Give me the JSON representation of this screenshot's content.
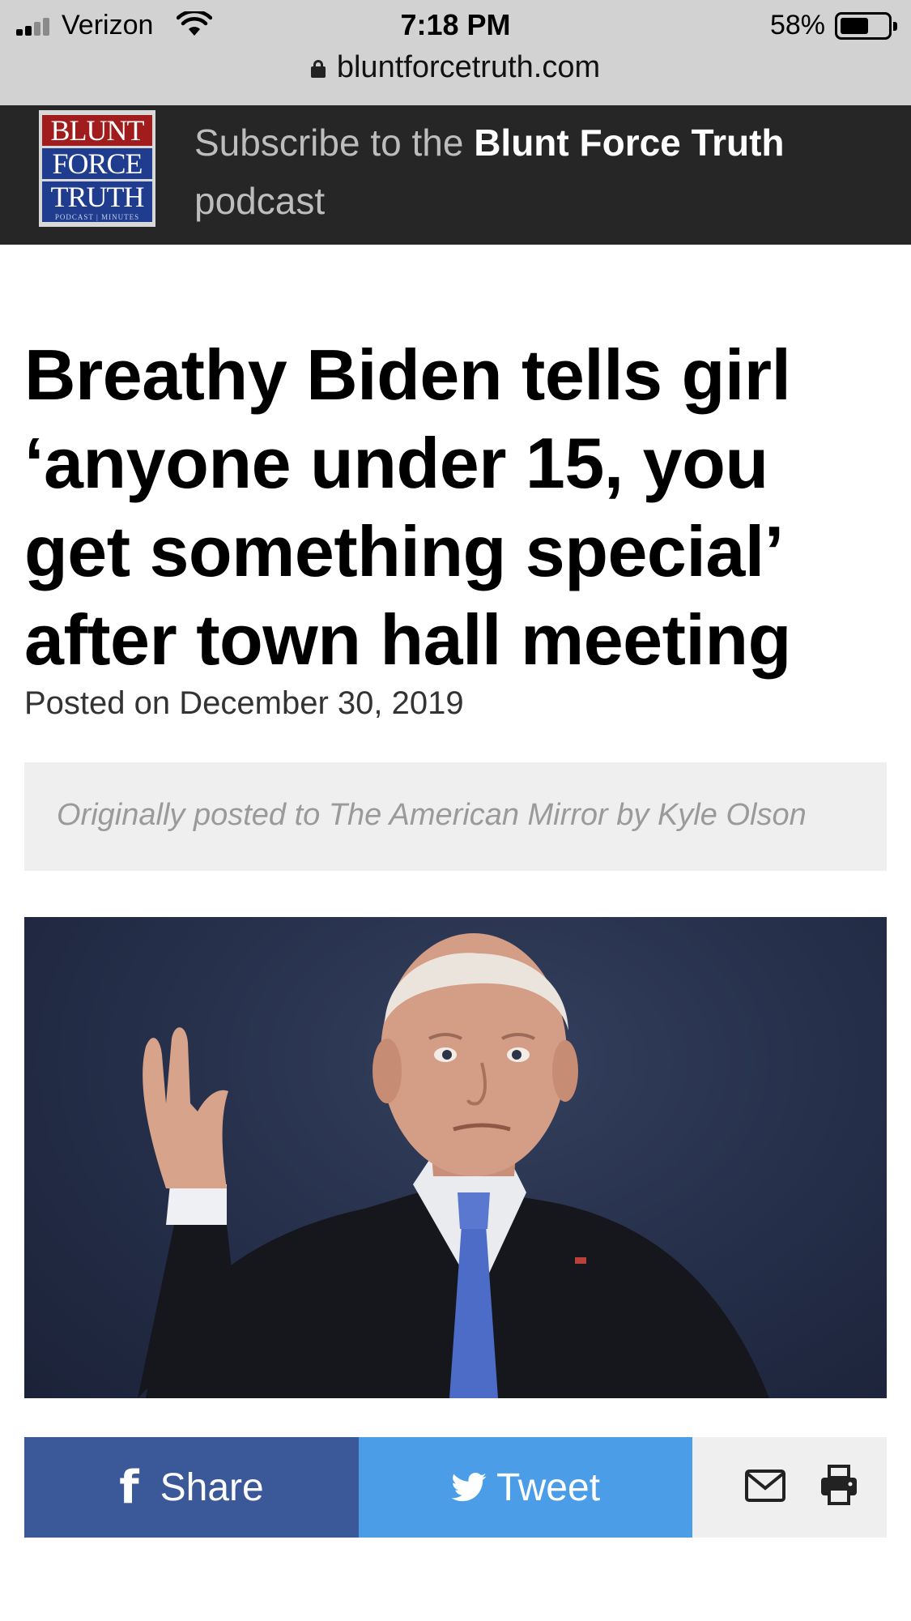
{
  "status_bar": {
    "carrier": "Verizon",
    "time": "7:18 PM",
    "battery_percent": "58%",
    "battery_level": 0.58
  },
  "browser": {
    "url": "bluntforcetruth.com"
  },
  "header": {
    "logo": {
      "line1": "BLUNT",
      "line2": "FORCE",
      "line3": "TRUTH",
      "line4": "PODCAST | MINUTES"
    },
    "subscribe_prefix": "Subscribe to the ",
    "subscribe_bold": "Blunt Force Truth",
    "subscribe_suffix": "podcast"
  },
  "article": {
    "headline": "Breathy Biden tells girl ‘anyone under 15, you get something special’ after town hall meeting",
    "posted": "Posted on December 30, 2019",
    "source_note": "Originally posted to The American Mirror by Kyle Olson"
  },
  "share": {
    "share_label": "Share",
    "tweet_label": "Tweet"
  },
  "colors": {
    "facebook": "#3b5998",
    "twitter": "#4a9de6",
    "header_bg": "#262626"
  }
}
